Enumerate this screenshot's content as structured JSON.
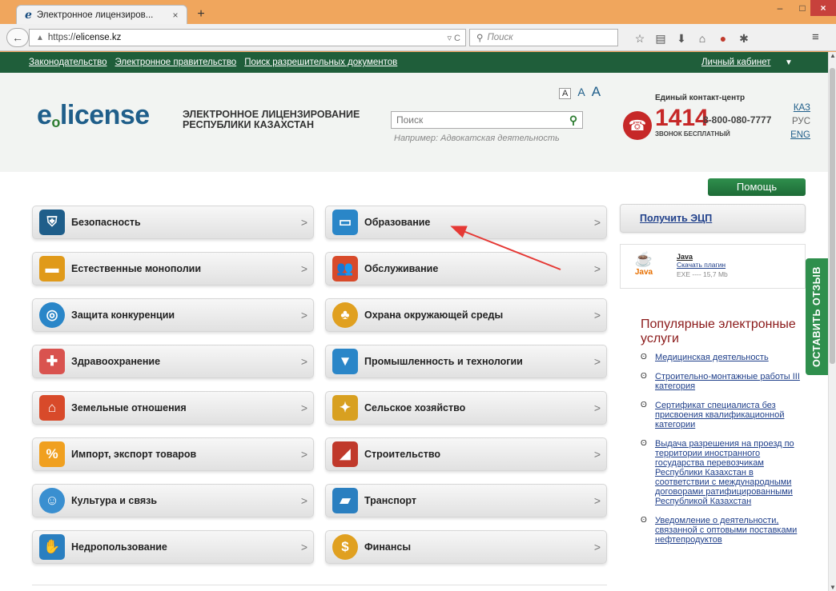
{
  "browser": {
    "tab_title": "Электронное лицензиров...",
    "tab_close": "×",
    "new_tab": "+",
    "url_scheme": "https://",
    "url_host": "elicense.kz",
    "search_placeholder": "Поиск",
    "window_controls": {
      "minimize": "–",
      "maximize": "□",
      "close": "×"
    }
  },
  "topnav": {
    "links": [
      "Законодательство",
      "Электронное правительство",
      "Поиск разрешительных документов"
    ],
    "cabinet": "Личный кабинет"
  },
  "header": {
    "logo_main": "license",
    "logo_prefix": "e",
    "logo_sub": "o",
    "logo_text_line1": "ЭЛЕКТРОННОЕ ЛИЦЕНЗИРОВАНИЕ",
    "logo_text_line2": "РЕСПУБЛИКИ КАЗАХСТАН",
    "font_sizes": [
      "A",
      "A",
      "A"
    ],
    "search_placeholder": "Поиск",
    "search_hint": "Например: Адвокатская деятельность",
    "contact_label": "Единый контакт-центр",
    "phone_short": "1414",
    "phone_long": "8-800-080-7777",
    "phone_free": "ЗВОНОК БЕСПЛАТНЫЙ",
    "languages": [
      "КАЗ",
      "РУС",
      "ENG"
    ]
  },
  "categories_left": [
    {
      "label": "Безопасность",
      "icon": "shield-icon",
      "color": "#1f5e8a"
    },
    {
      "label": "Естественные монополии",
      "icon": "briefcase-icon",
      "color": "#e09a1a"
    },
    {
      "label": "Защита конкуренции",
      "icon": "target-icon",
      "color": "#2a86c8"
    },
    {
      "label": "Здравоохранение",
      "icon": "first-aid-icon",
      "color": "#d9534f"
    },
    {
      "label": "Земельные отношения",
      "icon": "house-icon",
      "color": "#d84a2a"
    },
    {
      "label": "Импорт, экспорт товаров",
      "icon": "percent-icon",
      "color": "#f0a020"
    },
    {
      "label": "Культура и связь",
      "icon": "theater-masks-icon",
      "color": "#3a8fd0"
    },
    {
      "label": "Недропользование",
      "icon": "handshake-icon",
      "color": "#2a7fc0"
    }
  ],
  "categories_right": [
    {
      "label": "Образование",
      "icon": "book-icon",
      "color": "#2a86c8"
    },
    {
      "label": "Обслуживание",
      "icon": "people-icon",
      "color": "#d84a2a"
    },
    {
      "label": "Охрана окружающей среды",
      "icon": "tree-icon",
      "color": "#e0a020"
    },
    {
      "label": "Промышленность и технологии",
      "icon": "tie-icon",
      "color": "#2a86c8"
    },
    {
      "label": "Сельское хозяйство",
      "icon": "wheat-icon",
      "color": "#d8a020"
    },
    {
      "label": "Строительство",
      "icon": "trowel-icon",
      "color": "#c0392b"
    },
    {
      "label": "Транспорт",
      "icon": "truck-icon",
      "color": "#2a7fc0"
    },
    {
      "label": "Финансы",
      "icon": "coin-icon",
      "color": "#e0a020"
    }
  ],
  "chevron": ">",
  "sidebar": {
    "help": "Помощь",
    "get_ecp": "Получить ЭЦП",
    "java_title": "Java",
    "java_link": "Скачать плагин",
    "java_meta": "EXE ---- 15,7 Mb",
    "java_logo": "Java",
    "feedback": "ОСТАВИТЬ ОТЗЫВ",
    "popular_title": "Популярные электронные услуги",
    "popular": [
      "Медицинская деятельность",
      "Строительно-монтажные работы III категория",
      "Сертификат специалиста без присвоения квалификационной категории",
      "Выдача разрешения на проезд по территории иностранного государства перевозчикам Республики Казахстан в соответствии с международными договорами ратифицированными Республикой Казахстан",
      "Уведомление о деятельности, связанной с оптовыми поставками нефтепродуктов"
    ]
  }
}
